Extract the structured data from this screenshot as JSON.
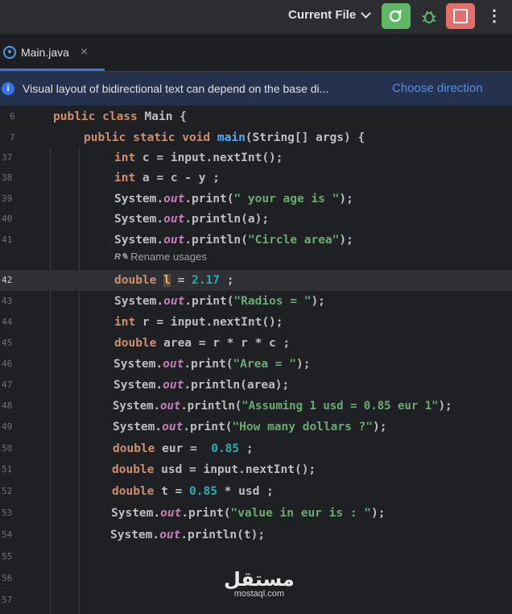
{
  "toolbar": {
    "current_file_label": "Current File",
    "run_icon": "run-icon",
    "debug_icon": "bug-icon",
    "stop_icon": "stop-icon",
    "more_icon": "more-vertical-icon",
    "more_glyph": "⋮"
  },
  "tabs": [
    {
      "label": "Main.java",
      "close": "×"
    }
  ],
  "banner": {
    "text": "Visual layout of bidirectional text can depend on the base di...",
    "link": "Choose direction",
    "info_glyph": "i"
  },
  "editor": {
    "inlay_hint": "Rename usages",
    "lines": [
      {
        "n": "6",
        "text": "public class Main {"
      },
      {
        "n": "7",
        "text": "public static void main(String[] args) {"
      },
      {
        "n": "37",
        "text": "int c = input.nextInt();"
      },
      {
        "n": "38",
        "text": "int a = c - y ;"
      },
      {
        "n": "39",
        "text": "System.out.print(\" your age is \");"
      },
      {
        "n": "40",
        "text": "System.out.println(a);"
      },
      {
        "n": "41",
        "text": "System.out.println(\"Circle area\");"
      },
      {
        "n": "42",
        "text": "double l = 2.17 ;"
      },
      {
        "n": "43",
        "text": "System.out.print(\"Radios = \");"
      },
      {
        "n": "44",
        "text": "int r = input.nextInt();"
      },
      {
        "n": "45",
        "text": "double area = r * r * c ;"
      },
      {
        "n": "46",
        "text": "System.out.print(\"Area = \");"
      },
      {
        "n": "47",
        "text": "System.out.println(area);"
      },
      {
        "n": "48",
        "text": "System.out.println(\"Assuming 1 usd = 0.85 eur 1\");"
      },
      {
        "n": "49",
        "text": "System.out.print(\"How many dollars ?\");"
      },
      {
        "n": "50",
        "text": "double eur =  0.85 ;"
      },
      {
        "n": "51",
        "text": "double usd = input.nextInt();"
      },
      {
        "n": "52",
        "text": "double t = 0.85 * usd ;"
      },
      {
        "n": "53",
        "text": "System.out.print(\"value in eur is : \");"
      },
      {
        "n": "54",
        "text": "System.out.println(t);"
      },
      {
        "n": "55",
        "text": ""
      },
      {
        "n": "56",
        "text": ""
      },
      {
        "n": "57",
        "text": ""
      }
    ]
  },
  "watermark": {
    "main": "مستقل",
    "sub": "mostaql.com"
  }
}
